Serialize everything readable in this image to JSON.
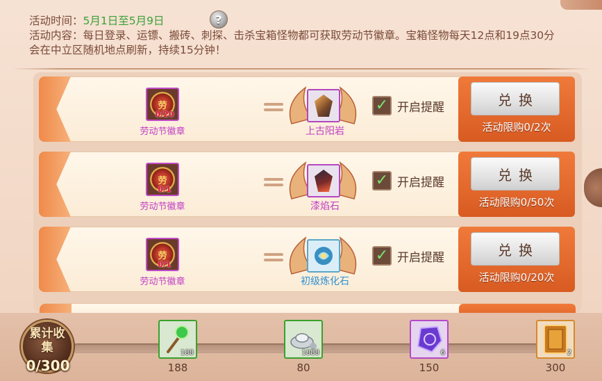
{
  "event": {
    "time_label": "活动时间：",
    "time_value": "5月1日至5月9日",
    "content": "活动内容：每日登录、运镖、搬砖、刺探、击杀宝箱怪物都可获取劳动节徽章。宝箱怪物每天12点和19点30分会在中立区随机地点刷新，持续15分钟！",
    "help_glyph": "?"
  },
  "rows": [
    {
      "badge_glyph": "劳",
      "badge_count": "0/20",
      "badge_name": "劳动节徽章",
      "item_name": "上古阳岩",
      "item_color": "#c03ec6",
      "item_icon": "sun-rock-crystal-icon",
      "remind_check": "✓",
      "remind_label": "开启提醒",
      "exchange_label": "兑换",
      "limit_text": "活动限购0/2次"
    },
    {
      "badge_glyph": "劳",
      "badge_count": "0/1",
      "badge_name": "劳动节徽章",
      "item_name": "漆焰石",
      "item_color": "#c03ec6",
      "item_icon": "flame-stone-icon",
      "remind_check": "✓",
      "remind_label": "开启提醒",
      "exchange_label": "兑换",
      "limit_text": "活动限购0/50次"
    },
    {
      "badge_glyph": "劳",
      "badge_count": "0/1",
      "badge_name": "劳动节徽章",
      "item_name": "初级炼化石",
      "item_color": "#2e92d4",
      "item_icon": "refining-stone-icon",
      "remind_check": "✓",
      "remind_label": "开启提醒",
      "exchange_label": "兑换",
      "limit_text": "活动限购0/20次"
    }
  ],
  "collection": {
    "label": "累计收集",
    "count": "0/300",
    "progress": 0,
    "rewards": [
      {
        "icon": "green-scepter-icon",
        "qty": "188",
        "threshold": "188",
        "quality": "green"
      },
      {
        "icon": "silver-ingot-icon",
        "qty": "1888",
        "threshold": "80",
        "quality": "green"
      },
      {
        "icon": "purple-gem-icon",
        "qty": "6",
        "threshold": "150",
        "quality": "purple"
      },
      {
        "icon": "golden-card-icon",
        "qty": "2",
        "threshold": "300",
        "quality": "orange"
      }
    ]
  },
  "colors": {
    "accent_green": "#3ba13a",
    "badge_purple": "#c03ec6",
    "button_orange": "#e0672b"
  }
}
